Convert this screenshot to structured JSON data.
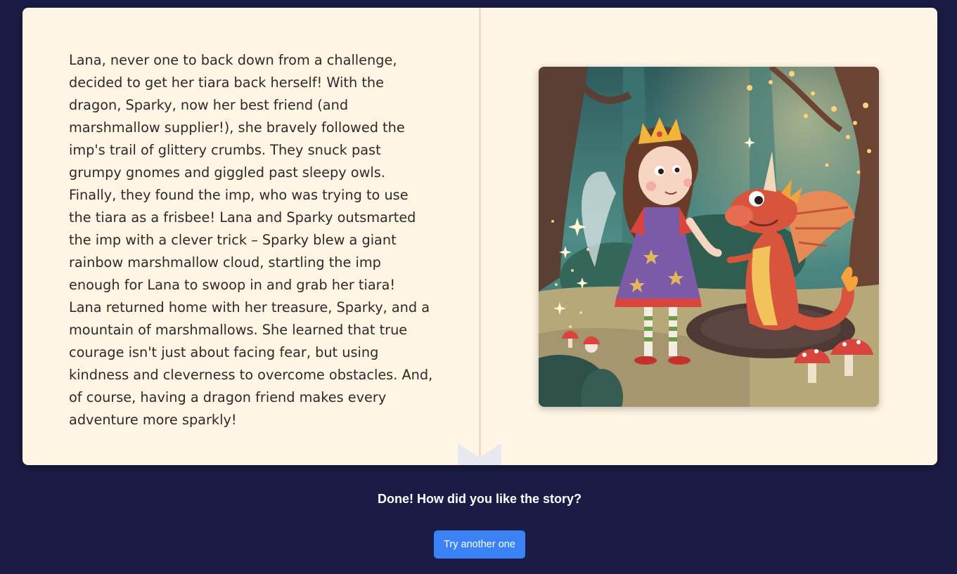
{
  "story": {
    "lines": [
      "Lana, never one to back down from a challenge,",
      "decided to get her tiara back herself! With the",
      "dragon, Sparky, now her best friend (and",
      "marshmallow supplier!), she bravely followed the",
      "imp's trail of glittery crumbs. They snuck past",
      "grumpy gnomes and giggled past sleepy owls.",
      "Finally, they found the imp, who was trying to use",
      "the tiara as a frisbee! Lana and Sparky outsmarted",
      "the imp with a clever trick – Sparky blew a giant",
      "rainbow marshmallow cloud, startling the imp",
      "enough for Lana to swoop in and grab her tiara!",
      "Lana returned home with her treasure, Sparky, and a",
      "mountain of marshmallows. She learned that true",
      "courage isn't just about facing fear, but using",
      "kindness and cleverness to overcome obstacles. And,",
      "of course, having a dragon friend makes every",
      "adventure more sparkly!"
    ]
  },
  "footer": {
    "done_message": "Done! How did you like the story?",
    "try_button_label": "Try another one"
  },
  "colors": {
    "background": "#1b1c45",
    "page": "#fef5e4",
    "button": "#3b82f6"
  }
}
